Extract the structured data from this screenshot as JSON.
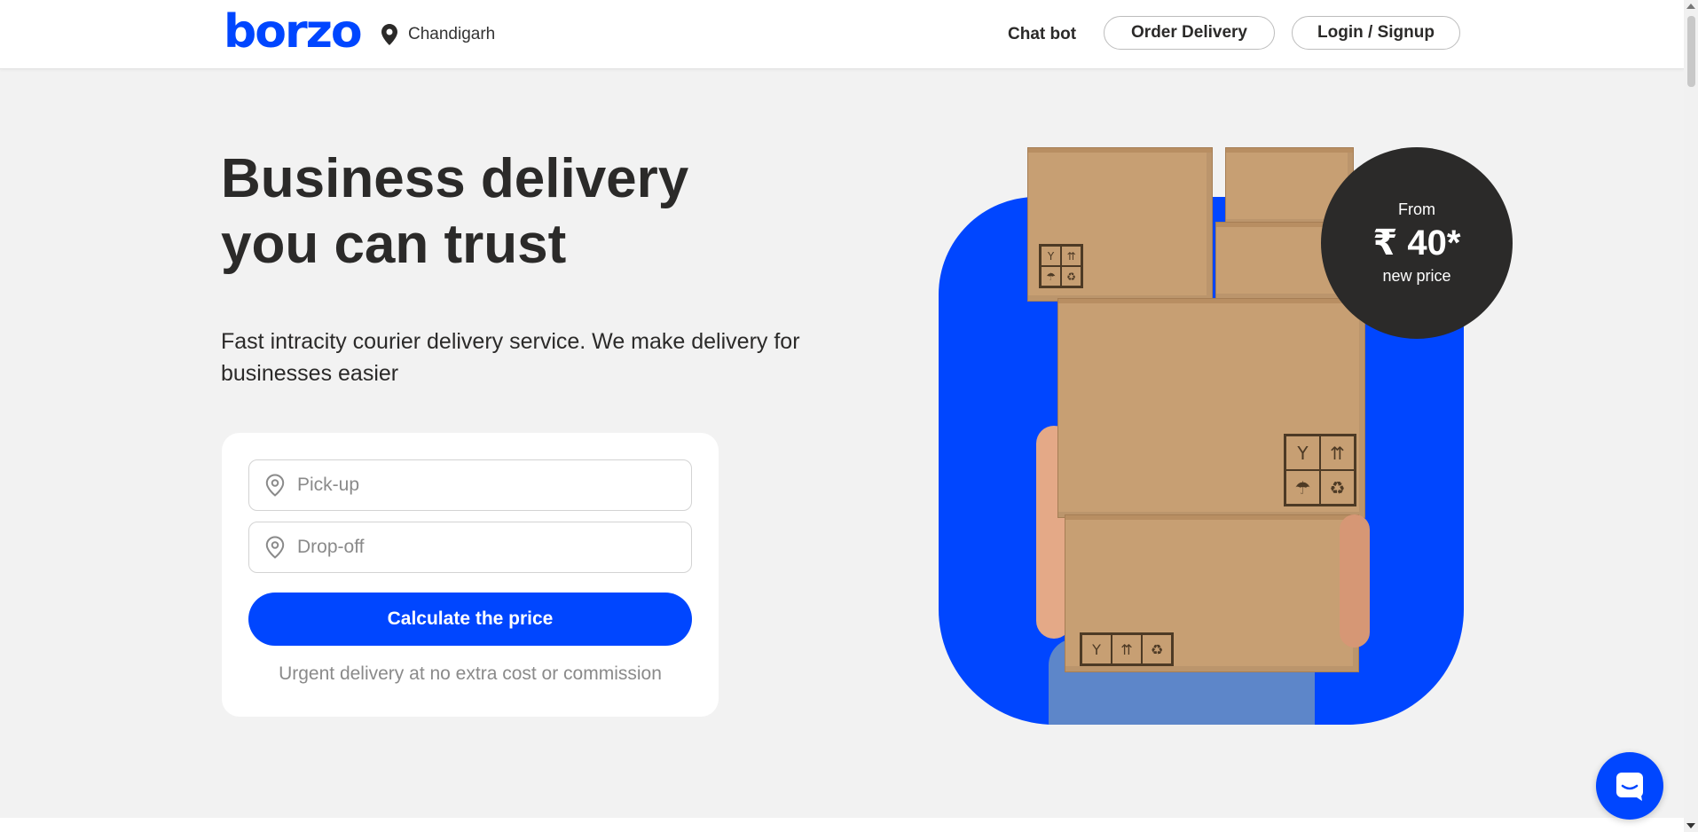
{
  "brand": {
    "logo_text": "borzo",
    "color": "#0046ff"
  },
  "header": {
    "city": "Chandigarh",
    "chat_bot": "Chat bot",
    "order_delivery": "Order Delivery",
    "login_signup": "Login / Signup"
  },
  "hero": {
    "title": "Business delivery\nyou can trust",
    "subtitle": "Fast intracity courier delivery service. We make delivery for businesses easier"
  },
  "calculator": {
    "pickup_placeholder": "Pick-up",
    "dropoff_placeholder": "Drop-off",
    "calculate_label": "Calculate the price",
    "note": "Urgent delivery at no extra cost or commission"
  },
  "price_badge": {
    "from": "From",
    "value": "₹ 40*",
    "note": "new price"
  },
  "icons": {
    "location": "location-pin-icon",
    "field_pin": "map-pin-outline-icon",
    "chat": "chat-bubble-icon"
  },
  "colors": {
    "background": "#f2f2f2",
    "text": "#2b2a29",
    "badge": "#2b2a29"
  }
}
